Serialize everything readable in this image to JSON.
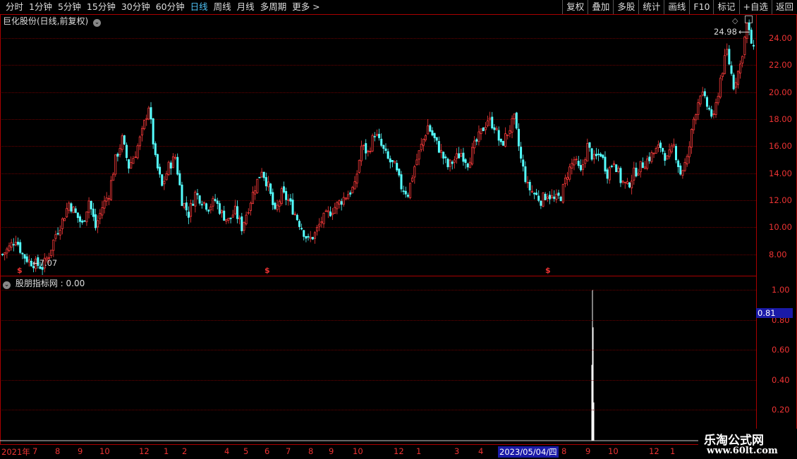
{
  "toolbar": {
    "periods": [
      "分时",
      "1分钟",
      "5分钟",
      "15分钟",
      "30分钟",
      "60分钟",
      "日线",
      "周线",
      "月线",
      "多周期",
      "更多 >"
    ],
    "active_period": "日线",
    "right_buttons": [
      "复权",
      "叠加",
      "多股",
      "统计",
      "画线",
      "F10",
      "标记",
      "+自选",
      "返回"
    ]
  },
  "main_chart": {
    "title": "巨化股份(日线,前复权)",
    "high_label": "24.98",
    "low_label": "7.07",
    "price_ticks": [
      "24.00",
      "22.00",
      "20.00",
      "18.00",
      "16.00",
      "14.00",
      "12.00",
      "10.00",
      "8.00"
    ],
    "markers": [
      "$",
      "$",
      "$"
    ]
  },
  "indicator": {
    "title": "股朋指标网 : 0.00",
    "ticks": [
      "1.00",
      "0.80",
      "0.60",
      "0.40",
      "0.20"
    ],
    "cursor_value": "0.81"
  },
  "date_axis": {
    "labels": [
      "2021年",
      "7",
      "8",
      "9",
      "10",
      "12",
      "1",
      "2",
      "4",
      "5",
      "6",
      "7",
      "8",
      "9",
      "10",
      "12",
      "1",
      "3",
      "4",
      "2023/05/04/四",
      "8",
      "9",
      "10",
      "12",
      "1"
    ],
    "highlight": "2023/05/04/四"
  },
  "watermark": {
    "title": "乐淘公式网",
    "url": "www.60lt.com"
  },
  "colors": {
    "up": "#ff3b3b",
    "down": "#54ffff",
    "axis": "#e33",
    "grid": "#6a0000",
    "active": "#4fc3f7"
  },
  "chart_data": {
    "type": "candlestick",
    "ylim": [
      7,
      25.5
    ],
    "close_path": [
      8.0,
      8.5,
      9.2,
      8.0,
      7.5,
      7.3,
      7.07,
      8.0,
      9.5,
      10.5,
      11.8,
      11.0,
      10.2,
      12.0,
      10.0,
      11.5,
      12.5,
      15.0,
      16.5,
      14.5,
      15.5,
      17.0,
      19.0,
      15.0,
      13.0,
      14.5,
      15.2,
      12.0,
      11.0,
      12.5,
      12.0,
      11.5,
      12.0,
      11.0,
      10.5,
      11.2,
      10.0,
      11.5,
      13.0,
      14.3,
      13.0,
      11.0,
      12.5,
      12.0,
      11.0,
      10.0,
      9.0,
      9.5,
      10.5,
      11.0,
      11.5,
      12.0,
      12.5,
      13.0,
      16.0,
      15.5,
      17.0,
      16.0,
      15.0,
      14.5,
      13.0,
      12.5,
      14.5,
      16.0,
      17.5,
      16.5,
      15.5,
      14.5,
      15.0,
      15.5,
      14.8,
      16.0,
      17.0,
      18.0,
      17.5,
      16.0,
      17.0,
      18.0,
      15.0,
      13.0,
      12.5,
      12.0,
      12.5,
      12.0,
      12.3,
      14.0,
      15.0,
      14.0,
      16.0,
      15.0,
      15.5,
      14.0,
      15.0,
      13.5,
      13.0,
      14.0,
      14.5,
      15.0,
      15.5,
      16.0,
      15.0,
      16.0,
      14.0,
      15.0,
      18.0,
      20.0,
      19.0,
      18.0,
      21.0,
      23.0,
      20.5,
      22.0,
      24.98,
      23.0
    ],
    "indicator_spike": {
      "index_fraction": 0.784,
      "value": 1.0
    }
  }
}
